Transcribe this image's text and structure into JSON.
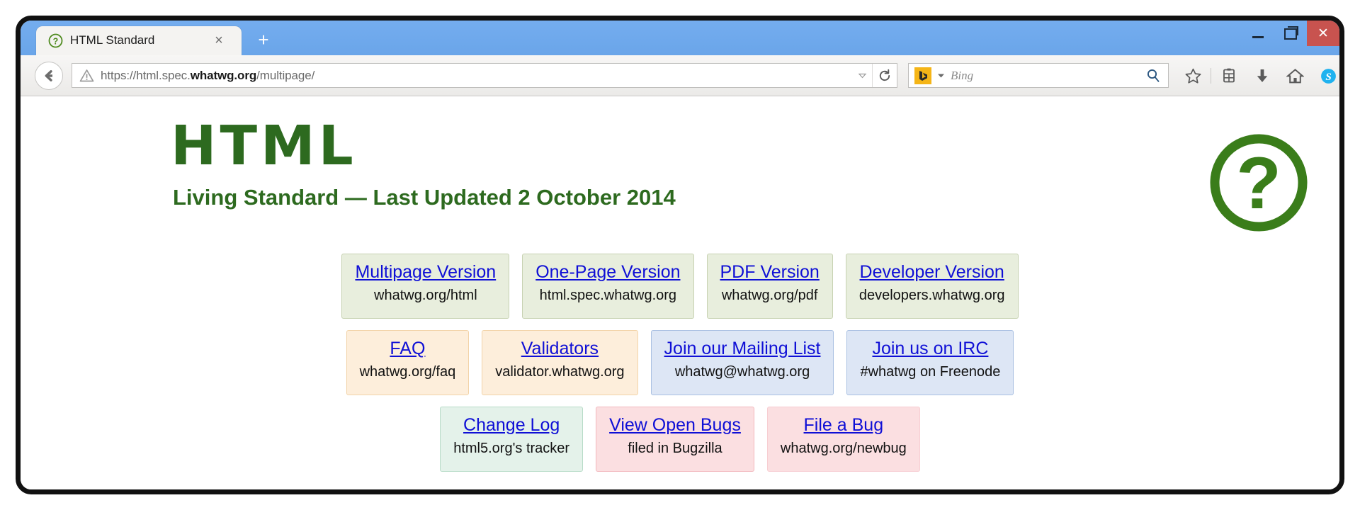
{
  "browser": {
    "tab": {
      "favicon": "question-mark-circle-icon",
      "title": "HTML Standard",
      "close_label": "×"
    },
    "new_tab_label": "+",
    "window_controls": {
      "minimize_label": "",
      "restore_label": "",
      "close_label": "✕"
    },
    "nav": {
      "back_icon": "back-arrow-icon",
      "site_identity_icon": "warning-triangle-icon",
      "url_scheme": "https://html.spec.",
      "url_host": "whatwg.org",
      "url_path": "/multipage/",
      "url_full": "https://html.spec.whatwg.org/multipage/",
      "dropmarker_icon": "chevron-down-icon",
      "reload_icon": "reload-icon"
    },
    "search": {
      "engine": "Bing",
      "engine_logo": "bing-logo-icon",
      "placeholder": "Bing",
      "go_icon": "search-icon"
    },
    "toolbar_icons": [
      {
        "name": "bookmark-star-icon",
        "label": "☆"
      },
      {
        "name": "reading-list-icon",
        "label": ""
      },
      {
        "name": "download-arrow-icon",
        "label": ""
      },
      {
        "name": "home-icon",
        "label": ""
      },
      {
        "name": "skype-icon",
        "label": "S"
      },
      {
        "name": "menu-kebab-icon",
        "label": "⋮"
      }
    ]
  },
  "page": {
    "logo": "whatwg-question-mark-logo",
    "title": "HTML",
    "subtitle": "Living Standard — Last Updated 2 October 2014",
    "title_color": "#2d6a1f",
    "link_color": "#0f0fd6",
    "rows": [
      {
        "row_name": "versions-row",
        "boxes": [
          {
            "name": "multipage-version",
            "link": "Multipage Version",
            "sub": "whatwg.org/html",
            "bg": "#e8eedd",
            "border": "#c7d2b2"
          },
          {
            "name": "one-page-version",
            "link": "One-Page Version",
            "sub": "html.spec.whatwg.org",
            "bg": "#e8eedd",
            "border": "#c7d2b2"
          },
          {
            "name": "pdf-version",
            "link": "PDF Version",
            "sub": "whatwg.org/pdf",
            "bg": "#e8eedd",
            "border": "#c7d2b2"
          },
          {
            "name": "developer-version",
            "link": "Developer Version",
            "sub": "developers.whatwg.org",
            "bg": "#e8eedd",
            "border": "#c7d2b2"
          }
        ]
      },
      {
        "row_name": "community-row",
        "boxes": [
          {
            "name": "faq",
            "link": "FAQ",
            "sub": "whatwg.org/faq",
            "bg": "#fdeedb",
            "border": "#f2d3a8"
          },
          {
            "name": "validators",
            "link": "Validators",
            "sub": "validator.whatwg.org",
            "bg": "#fdeedb",
            "border": "#f2d3a8"
          },
          {
            "name": "mailing-list",
            "link": "Join our Mailing List",
            "sub": "whatwg@whatwg.org",
            "bg": "#dde6f5",
            "border": "#a9c0e2"
          },
          {
            "name": "irc",
            "link": "Join us on IRC",
            "sub": "#whatwg on Freenode",
            "bg": "#dde6f5",
            "border": "#a9c0e2"
          }
        ]
      },
      {
        "row_name": "tracking-row",
        "boxes": [
          {
            "name": "change-log",
            "link": "Change Log",
            "sub": "html5.org's tracker",
            "bg": "#e4f2ea",
            "border": "#b8dcc8"
          },
          {
            "name": "view-open-bugs",
            "link": "View Open Bugs",
            "sub": "filed in Bugzilla",
            "bg": "#fbdfe1",
            "border": "#f2b8bd"
          },
          {
            "name": "file-a-bug",
            "link": "File a Bug",
            "sub": "whatwg.org/newbug",
            "bg": "#fbdfe1",
            "border": "#f7cdd2"
          }
        ]
      }
    ]
  }
}
